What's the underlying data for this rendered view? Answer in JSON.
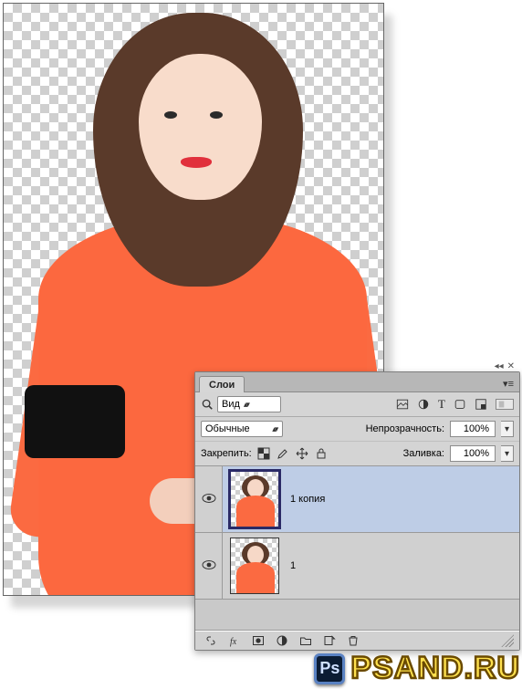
{
  "panel": {
    "title": "Слои",
    "filter_label": "Вид",
    "blend_mode": "Обычные",
    "opacity_label": "Непрозрачность:",
    "opacity_value": "100%",
    "lock_label": "Закрепить:",
    "fill_label": "Заливка:",
    "fill_value": "100%",
    "filter_icons": [
      "image-filter-icon",
      "adjustment-filter-icon",
      "type-filter-icon",
      "shape-filter-icon",
      "smartobject-filter-icon"
    ],
    "lock_icons": [
      "lock-transparency-icon",
      "lock-brush-icon",
      "lock-position-icon",
      "lock-all-icon"
    ],
    "footer_icons": [
      "link-layers-icon",
      "layer-style-icon",
      "layer-mask-icon",
      "adjustment-layer-icon",
      "group-icon",
      "new-layer-icon",
      "delete-layer-icon"
    ],
    "layers": [
      {
        "name": "1 копия",
        "visible": true,
        "selected": true
      },
      {
        "name": "1",
        "visible": true,
        "selected": false
      }
    ]
  },
  "watermark": {
    "badge": "Ps",
    "text": "PSAND.RU"
  }
}
